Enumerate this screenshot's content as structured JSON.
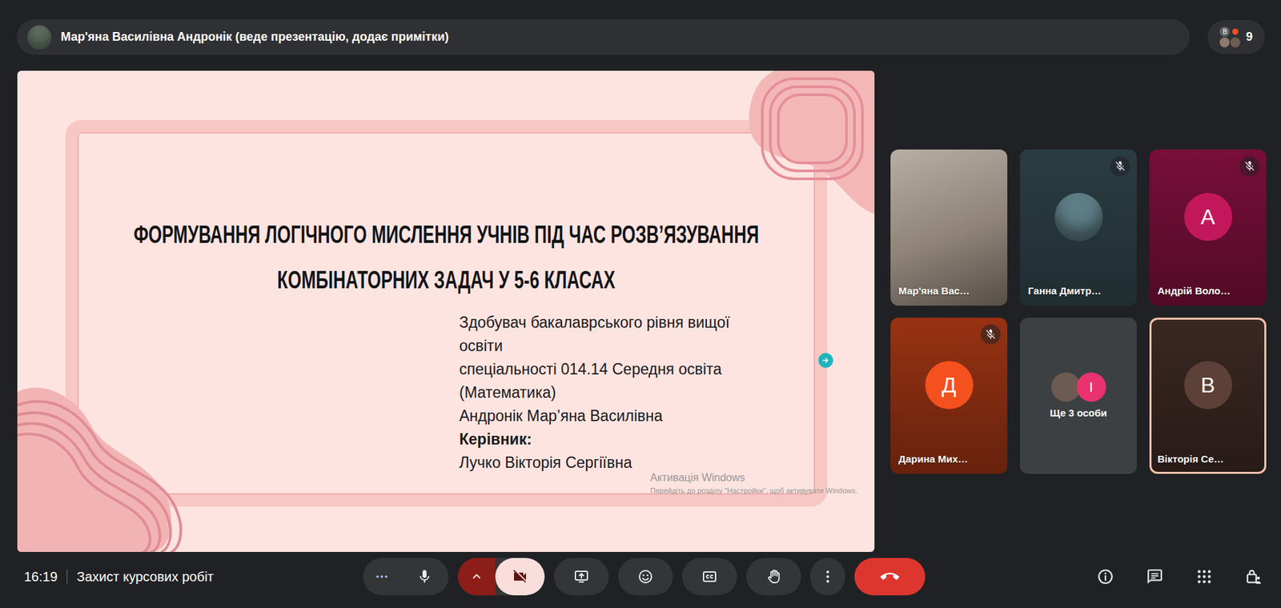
{
  "call": {
    "presenter": {
      "label": "Мар'яна Василівна Андронік (веде презентацію, додає примітки)",
      "avatar_color": "#5b6a5c"
    },
    "participants": {
      "count": "9",
      "avatars": [
        {
          "kind": "letter",
          "letter": "В",
          "color": "#5f6368"
        },
        {
          "kind": "dot",
          "color": "#f4511e"
        },
        {
          "kind": "photo",
          "color": "#8d7a6a"
        },
        {
          "kind": "photo",
          "color": "#6b5d52"
        }
      ]
    }
  },
  "slide": {
    "title_lines": [
      "ФОРМУВАННЯ ЛОГІЧНОГО МИСЛЕННЯ УЧНІВ ПІД ЧАС РОЗВ’ЯЗУВАННЯ",
      "КОМБІНАТОРНИХ ЗАДАЧ У 5-6 КЛАСАХ"
    ],
    "author_lines": [
      {
        "text": "Здобувач бакалаврського рівня вищої",
        "bold": false
      },
      {
        "text": "освіти",
        "bold": false
      },
      {
        "text": "спеціальності 014.14 Середня освіта",
        "bold": false
      },
      {
        "text": "(Математика)",
        "bold": false
      },
      {
        "text": "Андронік Мар’яна Василівна",
        "bold": false
      },
      {
        "text": "Керівник:",
        "bold": true
      },
      {
        "text": "Лучко Вікторія Сергіївна",
        "bold": false
      }
    ],
    "watermark": {
      "title": "Активація Windows",
      "hint": "Перейдіть до розділу \"Настройки\", щоб активувати Windows."
    }
  },
  "tiles": [
    {
      "name": "Мар'яна Вас…",
      "kind": "video",
      "muted": false,
      "speaking": false,
      "color": "#8f8378"
    },
    {
      "name": "Ганна Дмитр…",
      "kind": "photo",
      "muted": true,
      "speaking": false,
      "color": "#5f7d86"
    },
    {
      "name": "Андрій Воло…",
      "kind": "letter",
      "letter": "А",
      "muted": true,
      "speaking": false,
      "color": "#c2185b"
    },
    {
      "name": "Дарина Мих…",
      "kind": "letter",
      "letter": "Д",
      "muted": true,
      "speaking": false,
      "color": "#f4511e"
    },
    {
      "name": "Ще 3 особи",
      "kind": "group",
      "muted": false,
      "speaking": false,
      "color": "#3c4043",
      "avatars": [
        {
          "kind": "photo",
          "color": "#6d5a50"
        },
        {
          "kind": "letter",
          "letter": "І",
          "color": "#e8336e"
        }
      ]
    },
    {
      "name": "Вікторія Се…",
      "kind": "letter",
      "letter": "В",
      "muted": false,
      "speaking": true,
      "color": "#5d4037"
    }
  ],
  "bottom_bar": {
    "time": "16:19",
    "meeting_title": "Захист курсових робіт",
    "controls": [
      {
        "kind": "mic",
        "on": true
      },
      {
        "kind": "camera",
        "on": false
      },
      {
        "kind": "present"
      },
      {
        "kind": "emoji"
      },
      {
        "kind": "captions"
      },
      {
        "kind": "hand"
      },
      {
        "kind": "more"
      },
      {
        "kind": "leave"
      }
    ],
    "side_buttons": [
      {
        "kind": "info"
      },
      {
        "kind": "chat"
      },
      {
        "kind": "activities"
      },
      {
        "kind": "host-controls"
      }
    ]
  }
}
